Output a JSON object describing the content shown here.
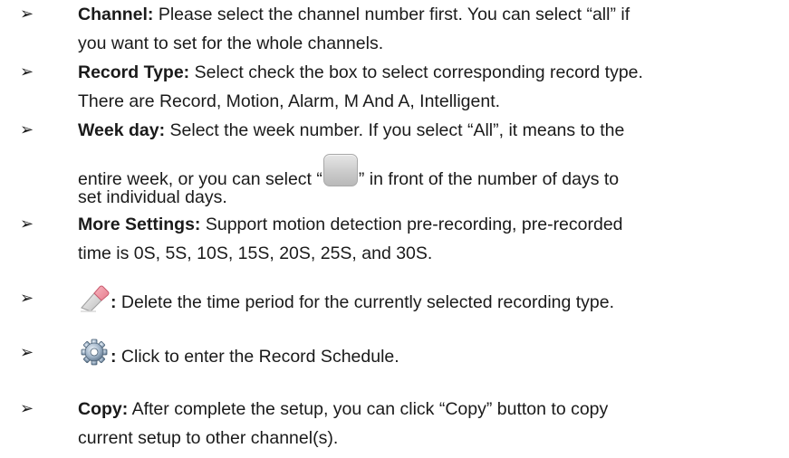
{
  "items": [
    {
      "term": "Channel:",
      "lines": [
        "Please select the channel number first. You can select “all” if",
        "you want to set for the whole channels."
      ]
    },
    {
      "term": "Record Type:",
      "lines": [
        "Select check the box to select corresponding record type.",
        "There are Record, Motion, Alarm, M And A, Intelligent."
      ]
    },
    {
      "term": "Week day:",
      "lines": [
        "Select the week number. If you select “All”, it means to the",
        "entire week, or you can select “",
        "” in front of the number of days to",
        "set individual days."
      ]
    },
    {
      "term": "More Settings:",
      "lines": [
        "Support motion detection pre-recording, pre-recorded",
        "time is 0S, 5S, 10S, 15S, 20S, 25S, and 30S."
      ]
    },
    {
      "term": ":",
      "icon": "eraser-icon",
      "lines": [
        "Delete the time period for the currently selected recording type."
      ]
    },
    {
      "term": ":",
      "icon": "gear-icon",
      "lines": [
        "Click to enter the Record Schedule."
      ]
    },
    {
      "term": "Copy:",
      "lines": [
        "After complete the setup, you can click “Copy” button to copy",
        "current setup to other channel(s)."
      ]
    }
  ],
  "bullet_glyph": "➢",
  "inline_icon": "day-select-box-icon"
}
